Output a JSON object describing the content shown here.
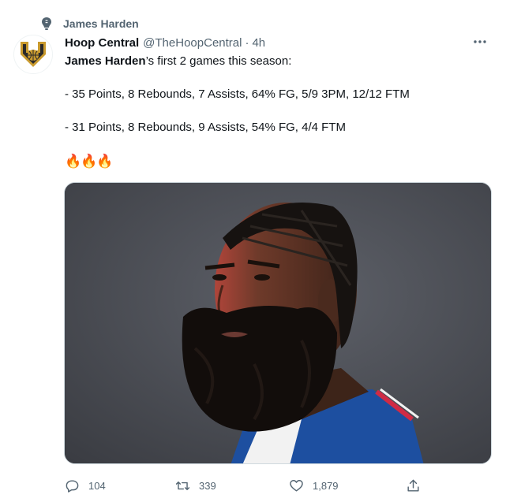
{
  "topic": {
    "label": "James Harden",
    "icon": "topic-icon"
  },
  "tweet": {
    "author_name": "Hoop Central",
    "handle": "@TheHoopCentral",
    "separator": "·",
    "time": "4h",
    "mention": "James Harden",
    "line1_rest": "’s first 2 games this season:",
    "line2": "- 35 Points, 8 Rebounds, 7 Assists, 64% FG, 5/9 3PM, 12/12 FTM",
    "line3": "- 31 Points, 8 Rebounds, 9 Assists, 54% FG, 4/4 FTM",
    "emojis": "🔥🔥🔥"
  },
  "media": {
    "description_icon": "photo-player-portrait"
  },
  "actions": {
    "replies": "104",
    "retweets": "339",
    "likes": "1,879"
  },
  "colors": {
    "text_primary": "#0f1419",
    "text_secondary": "#536471",
    "jersey_blue": "#1d4fa0",
    "jersey_red": "#d02b45"
  }
}
